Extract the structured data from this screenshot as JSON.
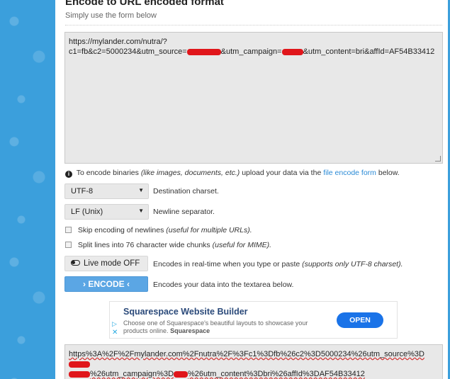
{
  "page": {
    "heading": "Encode to URL encoded format",
    "subheading": "Simply use the form below"
  },
  "input": {
    "line1": "https://mylander.com/nutra/?",
    "line2_a": "c1=fb&c2=5000234&utm_source=",
    "line2_b": "&utm_campaign=",
    "line2_c": "&utm_content=bri&affId=AF54B33412"
  },
  "info": {
    "prefix": "To encode binaries",
    "paren": "(like images, documents, etc.)",
    "middle": "upload your data via the",
    "link": "file encode form",
    "suffix": "below."
  },
  "charset": {
    "value": "UTF-8",
    "label": "Destination charset."
  },
  "newline": {
    "value": "LF (Unix)",
    "label": "Newline separator."
  },
  "options": {
    "skip_label": "Skip encoding of newlines",
    "skip_note": "(useful for multiple URLs).",
    "split_label": "Split lines into 76 character wide chunks",
    "split_note": "(useful for MIME)."
  },
  "live_mode": {
    "label": "Live mode OFF",
    "desc": "Encodes in real-time when you type or paste",
    "note": "(supports only UTF-8 charset)."
  },
  "encode": {
    "label": "› ENCODE ‹",
    "desc": "Encodes your data into the textarea below."
  },
  "ad": {
    "title": "Squarespace Website Builder",
    "desc": "Choose one of Squarespace's beautiful layouts to showcase your products online.",
    "brand": "Squarespace",
    "button": "OPEN"
  },
  "output": {
    "line1_a": "https%3A%2F%2Fmylander.com%2Fnutra%2F%3Fc1%3Dfb%26c2%3D5000234%26utm_source%3D",
    "line2_a": "%26utm_campaign%3D",
    "line2_b": "%26utm_content%3Dbri%26affId%3DAF54B33412"
  },
  "colors": {
    "sidebar": "#3b9fdc",
    "encode_button": "#5ba6e4",
    "link": "#2a8ad6",
    "redaction": "#e0161b",
    "ad_button": "#1a73e8"
  }
}
